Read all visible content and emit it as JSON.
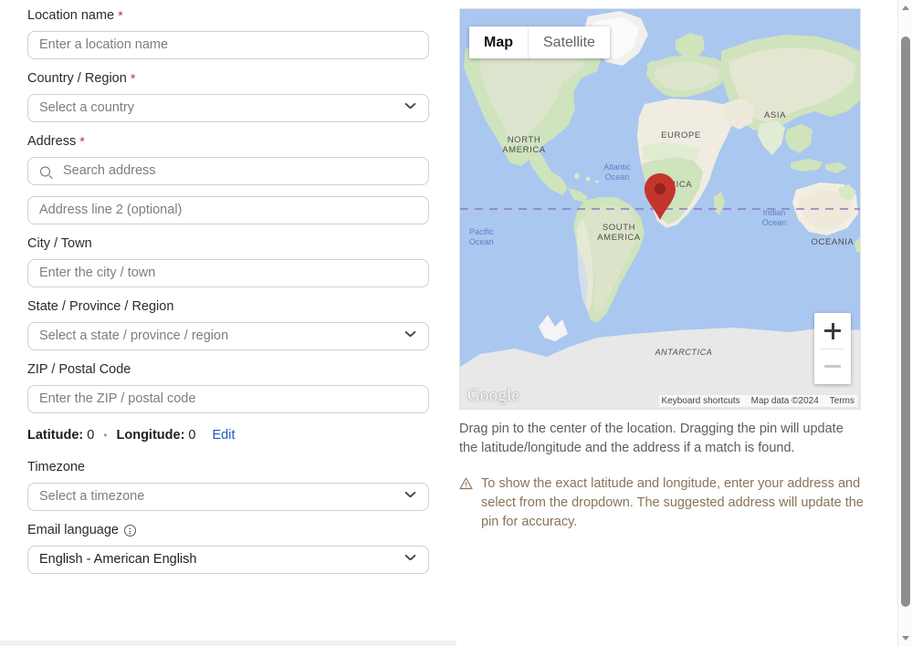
{
  "form": {
    "fields": [
      {
        "label": "Location name",
        "required": true,
        "type": "text",
        "placeholder": "Enter a location name",
        "value": ""
      },
      {
        "label": "Country / Region",
        "required": true,
        "type": "select",
        "placeholder": "Select a country",
        "value": ""
      },
      {
        "label": "Address",
        "required": true,
        "type": "search",
        "placeholder": "Search address",
        "value": ""
      },
      {
        "label": "",
        "required": false,
        "type": "text",
        "placeholder": "Address line 2 (optional)",
        "value": ""
      },
      {
        "label": "City / Town",
        "required": false,
        "type": "text",
        "placeholder": "Enter the city / town",
        "value": ""
      },
      {
        "label": "State / Province / Region",
        "required": false,
        "type": "select",
        "placeholder": "Select a state / province / region",
        "value": ""
      },
      {
        "label": "ZIP / Postal Code",
        "required": false,
        "type": "text",
        "placeholder": "Enter the ZIP / postal code",
        "value": ""
      },
      {
        "label": "Timezone",
        "required": false,
        "type": "select",
        "placeholder": "Select a timezone",
        "value": ""
      },
      {
        "label": "Email language",
        "required": false,
        "type": "select",
        "placeholder": "",
        "value": "English - American English",
        "info": true
      }
    ],
    "coordinates": {
      "latitude_label": "Latitude:",
      "latitude_value": "0",
      "separator": "•",
      "longitude_label": "Longitude:",
      "longitude_value": "0",
      "edit_link": "Edit"
    },
    "required_marker": "*"
  },
  "map": {
    "types": [
      {
        "label": "Map",
        "active": true
      },
      {
        "label": "Satellite",
        "active": false
      }
    ],
    "zoom_in_label": "+",
    "zoom_out_label": "−",
    "watermark": "Google",
    "attribution": {
      "keyboard_shortcuts": "Keyboard shortcuts",
      "map_data": "Map data ©2024",
      "terms": "Terms"
    },
    "labels": [
      {
        "text": "NORTH AMERICA",
        "kind": "continent"
      },
      {
        "text": "SOUTH AMERICA",
        "kind": "continent"
      },
      {
        "text": "EUROPE",
        "kind": "continent"
      },
      {
        "text": "ASIA",
        "kind": "continent"
      },
      {
        "text": "AFRICA",
        "kind": "continent"
      },
      {
        "text": "OCEANIA",
        "kind": "continent"
      },
      {
        "text": "ANTARCTICA",
        "kind": "continent"
      },
      {
        "text": "Atlantic Ocean",
        "kind": "ocean"
      },
      {
        "text": "Pacific Ocean",
        "kind": "ocean"
      },
      {
        "text": "Indian Ocean",
        "kind": "ocean"
      }
    ],
    "pin": {
      "latitude": 0,
      "longitude": 0,
      "color": "#c4352b"
    }
  },
  "help": {
    "drag_text": "Drag pin to the center of the location. Dragging the pin will update the latitude/longitude and the address if a match is found.",
    "warning_text": "To show the exact latitude and longitude, enter your address and select from the dropdown. The suggested address will update the pin for accuracy."
  },
  "colors": {
    "accent_link": "#2257c4",
    "required": "#b1423a",
    "warning": "#8a7358",
    "pin": "#c4352b",
    "ocean": "#aac7f0",
    "land": "#f2efe9",
    "vegetation": "#c8e0b4"
  }
}
